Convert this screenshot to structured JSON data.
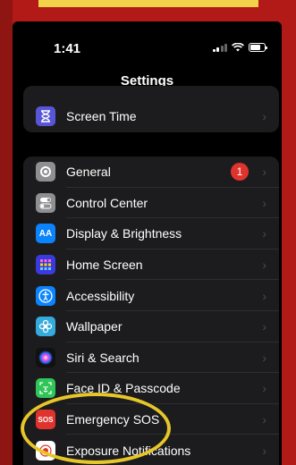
{
  "status_bar": {
    "time": "1:41"
  },
  "nav": {
    "title": "Settings"
  },
  "group_top": {
    "items": [
      {
        "label": "Screen Time",
        "icon": "hourglass-icon",
        "color": "#5856d6"
      }
    ]
  },
  "group_main": {
    "items": [
      {
        "label": "General",
        "icon": "gear-icon",
        "color": "#8e8e93",
        "badge": "1"
      },
      {
        "label": "Control Center",
        "icon": "toggles-icon",
        "color": "#8e8e93"
      },
      {
        "label": "Display & Brightness",
        "icon": "aa-icon",
        "glyph": "AA",
        "color": "#0a84ff"
      },
      {
        "label": "Home Screen",
        "icon": "home-grid-icon",
        "color": "#3a3ade"
      },
      {
        "label": "Accessibility",
        "icon": "accessibility-icon",
        "color": "#0a84ff"
      },
      {
        "label": "Wallpaper",
        "icon": "flower-icon",
        "color": "#35aadc"
      },
      {
        "label": "Siri & Search",
        "icon": "siri-icon",
        "color": "#222"
      },
      {
        "label": "Face ID & Passcode",
        "icon": "face-id-icon",
        "color": "#30c559"
      },
      {
        "label": "Emergency SOS",
        "icon": "sos-icon",
        "glyph": "SOS",
        "color": "#e0332d"
      },
      {
        "label": "Exposure Notifications",
        "icon": "exposure-icon",
        "color": "#fff"
      }
    ]
  },
  "colors": {
    "frame": "#b11a16",
    "highlight": "#e6c629",
    "badge": "#e0332d"
  }
}
